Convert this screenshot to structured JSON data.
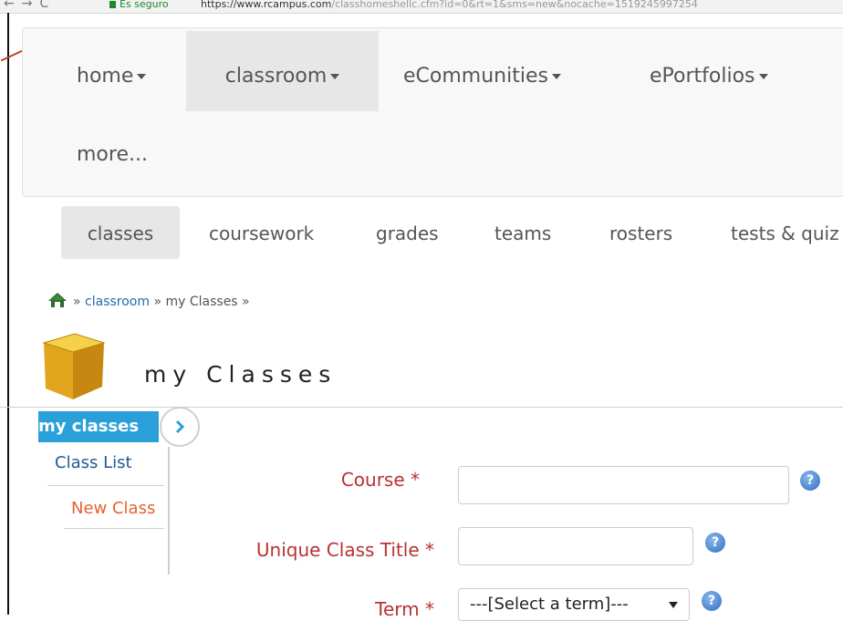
{
  "browser": {
    "secure_label": "Es seguro",
    "url_host": "https://www.rcampus.com",
    "url_path": "/classhomeshellc.cfm?id=0&rt=1&sms=new&nocache=1519245997254"
  },
  "topnav": {
    "items": [
      {
        "label": "home"
      },
      {
        "label": "classroom"
      },
      {
        "label": "eCommunities"
      },
      {
        "label": "ePortfolios"
      },
      {
        "label": "more..."
      }
    ]
  },
  "subnav": {
    "items": [
      {
        "label": "classes"
      },
      {
        "label": "coursework"
      },
      {
        "label": "grades"
      },
      {
        "label": "teams"
      },
      {
        "label": "rosters"
      },
      {
        "label": "tests & quiz"
      }
    ]
  },
  "breadcrumb": {
    "sep1": "»",
    "link": "classroom",
    "rest": "» my Classes »"
  },
  "page": {
    "title": "my Classes"
  },
  "sidebar": {
    "header": "my classes",
    "items": [
      {
        "label": "Class List"
      },
      {
        "label": "New Class"
      }
    ]
  },
  "form": {
    "course": {
      "label": "Course *",
      "value": ""
    },
    "unique_title": {
      "label": "Unique Class Title *",
      "value": ""
    },
    "term": {
      "label": "Term *",
      "selected": "---[Select a term]---"
    },
    "help_glyph": "?"
  },
  "colors": {
    "accent": "#2aa0d8",
    "required_label": "#b83232",
    "link": "#2a6aa8",
    "new_item": "#e8612c"
  }
}
